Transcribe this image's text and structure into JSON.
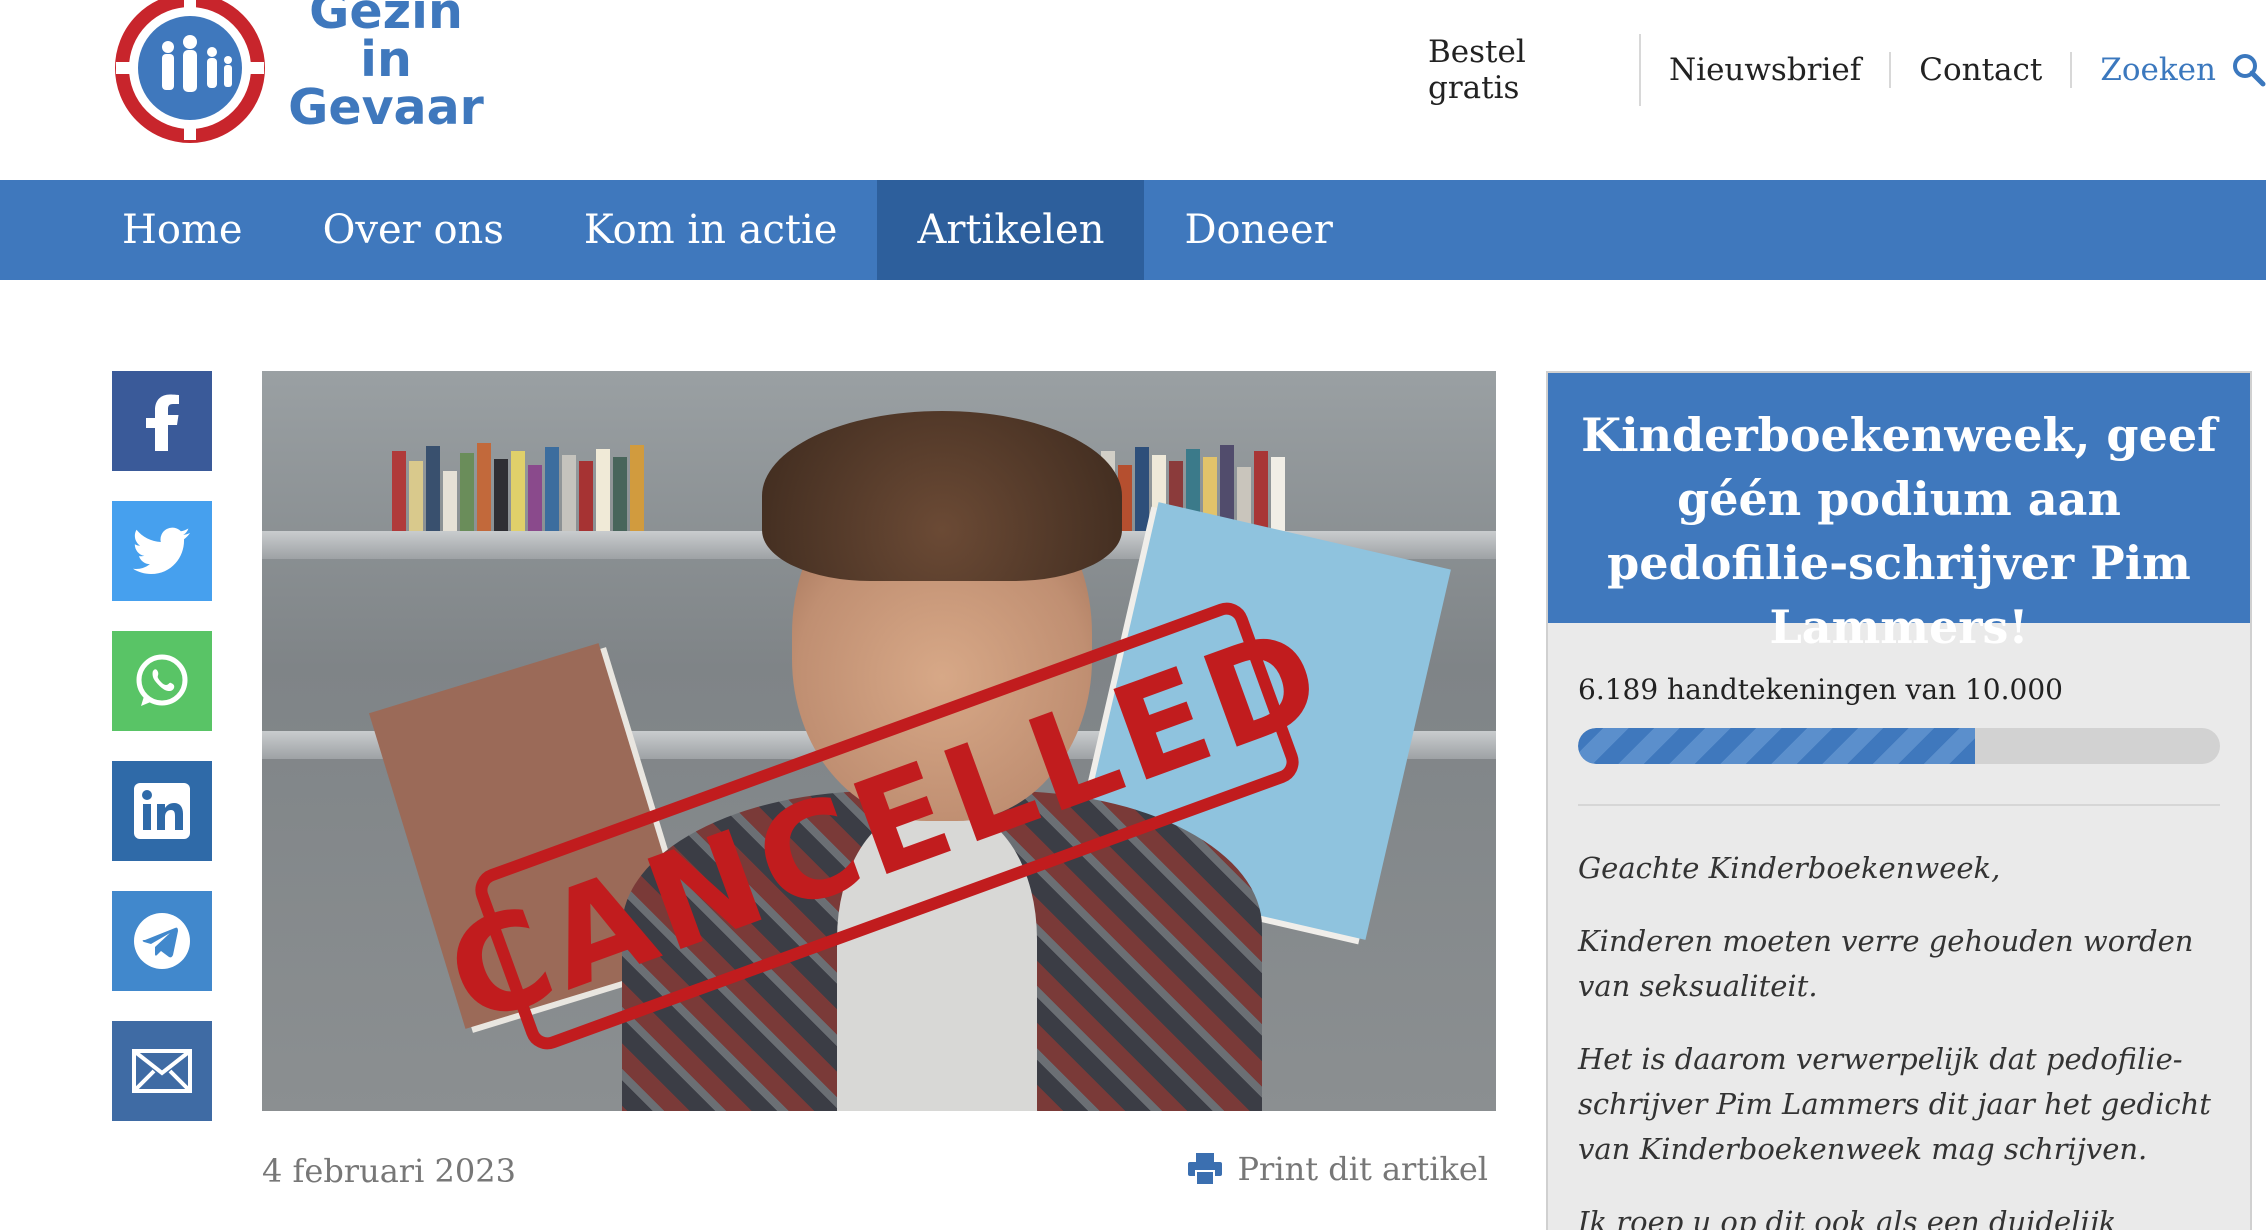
{
  "logo": {
    "line1": "Gezin",
    "line2": "in",
    "line3": "Gevaar"
  },
  "topnav": {
    "items": [
      "Bestel gratis",
      "Nieuwsbrief",
      "Contact"
    ],
    "search_label": "Zoeken"
  },
  "mainnav": {
    "items": [
      "Home",
      "Over ons",
      "Kom in actie",
      "Artikelen",
      "Doneer"
    ],
    "active": "Artikelen"
  },
  "social": {
    "icons": [
      "facebook-icon",
      "twitter-icon",
      "whatsapp-icon",
      "linkedin-icon",
      "telegram-icon",
      "email-icon"
    ]
  },
  "article": {
    "image_stamp_text": "CANCELLED",
    "date": "4 februari 2023",
    "print_label": "Print dit artikel"
  },
  "petition": {
    "title": "Kinderboekenweek, geef géén podium aan pedofilie-schrijver Pim Lammers!",
    "count_text": "6.189 handtekeningen van 10.000",
    "progress": 0.6189,
    "letter": [
      "Geachte Kinderboekenweek,",
      "Kinderen moeten verre gehouden worden van seksualiteit.",
      "Het is daarom verwerpelijk dat pedofilie-schrijver Pim Lammers dit jaar het gedicht van Kinderboekenweek mag schrijven.",
      "Ik roep u op dit ook als een duidelijk signaal richting Pim"
    ]
  },
  "colors": {
    "brand_blue": "#3f78bd",
    "active_nav": "#2d5f9c",
    "stamp_red": "#c11c1e"
  }
}
